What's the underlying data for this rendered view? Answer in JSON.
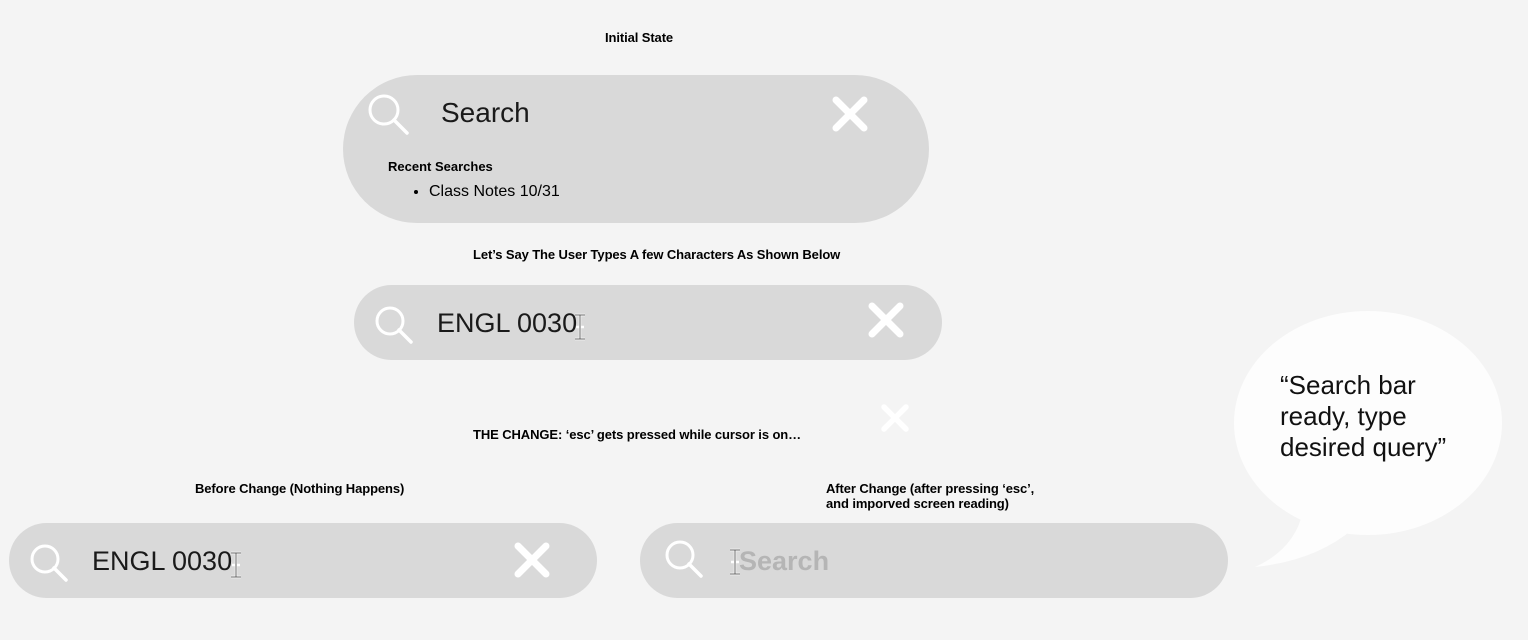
{
  "initial": {
    "caption": "Initial State",
    "search": {
      "placeholder": "Search"
    },
    "recent": {
      "title": "Recent Searches",
      "items": [
        "Class Notes 10/31"
      ]
    }
  },
  "typing": {
    "caption": "Let’s Say The User Types A few Characters As Shown Below",
    "search": {
      "value": "ENGL 0030"
    }
  },
  "change": {
    "caption": "THE CHANGE: ‘esc’ gets pressed while cursor is on…"
  },
  "before": {
    "caption": "Before Change (Nothing Happens)",
    "search": {
      "value": "ENGL 0030"
    }
  },
  "after": {
    "caption_line1": "After Change (after pressing ‘esc’,",
    "caption_line2": "and imporved screen reading)",
    "search": {
      "placeholder": "Search"
    }
  },
  "speech": {
    "line1": "“Search bar",
    "line2": "ready, type",
    "line3": "desired query”"
  },
  "icons": {
    "search": "search-icon",
    "clear": "close-icon",
    "cursor": "text-cursor-icon"
  },
  "colors": {
    "background": "#f4f4f4",
    "bar": "#d9d9d9",
    "icon_white": "#ffffff",
    "placeholder_gray": "#b5b5b5"
  }
}
